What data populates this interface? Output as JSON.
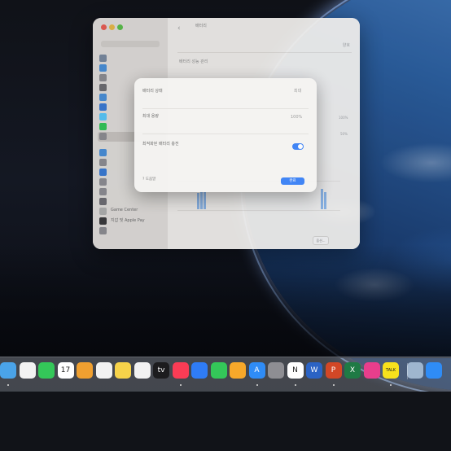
{
  "settings": {
    "header_title": "배터리",
    "header_subtitle": "",
    "sidebar_items": [
      {
        "label": "",
        "color": "#7a8aa0"
      },
      {
        "label": "",
        "color": "#4a90d9"
      },
      {
        "label": "",
        "color": "#8e8e93"
      },
      {
        "label": "",
        "color": "#6e6e73"
      },
      {
        "label": "",
        "color": "#4a90d9"
      },
      {
        "label": "",
        "color": "#3a7bd5"
      },
      {
        "label": "",
        "color": "#5ac8fa"
      },
      {
        "label": "",
        "color": "#34c759"
      },
      {
        "label": "",
        "color": "#8e8e93"
      },
      {
        "label": "",
        "color": "#4a90d9"
      },
      {
        "label": "",
        "color": "#8e8e93"
      },
      {
        "label": "",
        "color": "#3a7bd5"
      },
      {
        "label": "",
        "color": "#8e8e93"
      },
      {
        "label": "",
        "color": "#8e8e93"
      },
      {
        "label": "",
        "color": "#6e6e73"
      },
      {
        "label": "Game Center",
        "color": "#b0b0b0"
      },
      {
        "label": "지갑 및 Apple Pay",
        "color": "#3a3a3c"
      },
      {
        "label": "",
        "color": "#8e8e93"
      }
    ],
    "selected_index": 8,
    "rows": [
      {
        "label": "",
        "value": "양호"
      },
      {
        "label": "배터리 성능 관리",
        "value": ""
      }
    ],
    "chart_axis": [
      "",
      "",
      "",
      "",
      "",
      "",
      ""
    ],
    "chart_right_values": [
      "100%",
      "50%",
      "",
      "",
      "",
      ""
    ],
    "more_button": "옵션..."
  },
  "dialog": {
    "section1_title": "배터리 상태",
    "section1_value": "최대",
    "section1_desc_line1": "",
    "section1_desc_line2": "",
    "section2_title": "최대 용량",
    "section2_value": "100%",
    "section2_desc_line1": "",
    "section2_desc_line2": "",
    "section3_title": "최적화된 배터리 충전",
    "section3_desc_line1": "",
    "section3_desc_line2": "",
    "section3_desc_line3": "",
    "toggle_on": true,
    "help_label": "도움말",
    "done_label": "완료"
  },
  "dock": {
    "apps": [
      {
        "name": "finder",
        "glyph": "",
        "color": "#4aa3e8"
      },
      {
        "name": "photos",
        "glyph": "",
        "color": "#f2f2f2"
      },
      {
        "name": "facetime",
        "glyph": "",
        "color": "#34c759"
      },
      {
        "name": "calendar",
        "glyph": "17",
        "color": "#ffffff"
      },
      {
        "name": "passwords",
        "glyph": "",
        "color": "#f0a030"
      },
      {
        "name": "reminders",
        "glyph": "",
        "color": "#f2f2f2"
      },
      {
        "name": "notes",
        "glyph": "",
        "color": "#f7d34a"
      },
      {
        "name": "freeform",
        "glyph": "",
        "color": "#f2f2f2"
      },
      {
        "name": "appletv",
        "glyph": "tv",
        "color": "#1c1c1e"
      },
      {
        "name": "music",
        "glyph": "",
        "color": "#fa3c55"
      },
      {
        "name": "keynote",
        "glyph": "",
        "color": "#2f7cf6"
      },
      {
        "name": "numbers",
        "glyph": "",
        "color": "#34c759"
      },
      {
        "name": "pages",
        "glyph": "",
        "color": "#f7a82a"
      },
      {
        "name": "appstore",
        "glyph": "A",
        "color": "#2f8cf6"
      },
      {
        "name": "settings",
        "glyph": "",
        "color": "#8e8e93"
      },
      {
        "name": "notion",
        "glyph": "N",
        "color": "#ffffff"
      },
      {
        "name": "word",
        "glyph": "W",
        "color": "#2b63c4"
      },
      {
        "name": "powerpoint",
        "glyph": "P",
        "color": "#d24726"
      },
      {
        "name": "excel",
        "glyph": "X",
        "color": "#1f7a45"
      },
      {
        "name": "shortcut-pink",
        "glyph": "",
        "color": "#e83e8c"
      },
      {
        "name": "kakaotalk",
        "glyph": "TALK",
        "color": "#f7e11c"
      },
      {
        "name": "preview",
        "glyph": "",
        "color": "#9fb6cf"
      },
      {
        "name": "screen-app",
        "glyph": "",
        "color": "#2f8cf6"
      }
    ],
    "running_indices": [
      0,
      9,
      13,
      15,
      17,
      20
    ]
  }
}
